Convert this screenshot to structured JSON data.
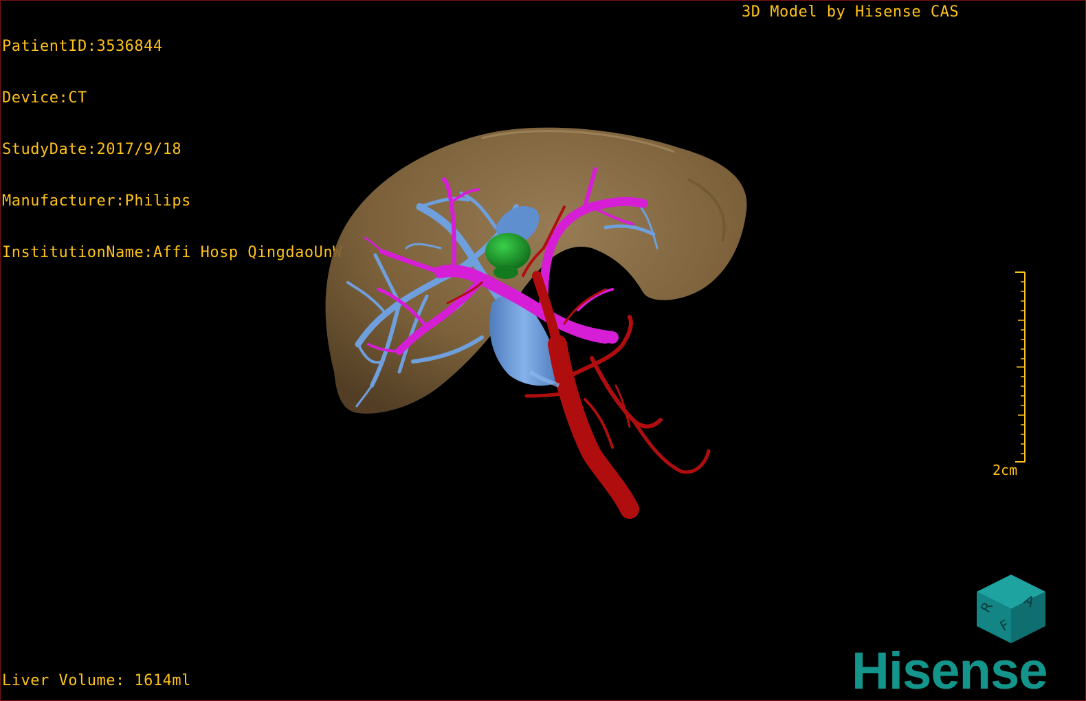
{
  "patient_info": {
    "patient_id": "PatientID:3536844",
    "device": "Device:CT",
    "study_date": "StudyDate:2017/9/18",
    "manufacturer": "Manufacturer:Philips",
    "institution": "InstitutionName:Affi Hosp QingdaoUnW"
  },
  "title": "3D Model by Hisense CAS",
  "liver_volume": "Liver Volume: 1614ml",
  "scale": {
    "label": "2cm"
  },
  "orientation_cube": {
    "labels": [
      "A",
      "R",
      "F"
    ],
    "color": "#1a8a8a"
  },
  "logo": {
    "text": "Hisense",
    "color": "#14958c"
  },
  "colors": {
    "overlay_text": "#ffc21a",
    "liver": "#8a6d45",
    "portal_vein": "#d61ed6",
    "hepatic_vein": "#6f9fdc",
    "artery": "#b00e0e",
    "tumor": "#1e9a2a"
  }
}
